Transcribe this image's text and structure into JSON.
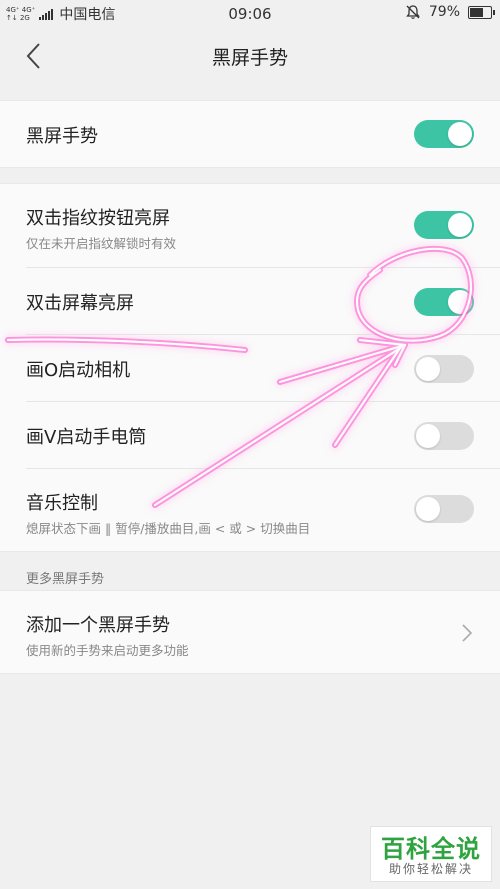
{
  "status_bar": {
    "network_top": "4G⁺ 4G⁺",
    "network_bottom": "↑↓ 2G",
    "carrier": "中国电信",
    "time": "09:06",
    "battery": "79%",
    "battery_level": 0.79
  },
  "navbar": {
    "title": "黑屏手势"
  },
  "section1": {
    "rows": [
      {
        "label": "黑屏手势",
        "enabled": true
      }
    ]
  },
  "section2": {
    "rows": [
      {
        "label": "双击指纹按钮亮屏",
        "sublabel": "仅在未开启指纹解锁时有效",
        "enabled": true
      },
      {
        "label": "双击屏幕亮屏",
        "enabled": true
      },
      {
        "label": "画O启动相机",
        "enabled": false
      },
      {
        "label": "画V启动手电筒",
        "enabled": false
      },
      {
        "label": "音乐控制",
        "sublabel": "熄屏状态下画 ‖ 暂停/播放曲目,画 < 或 > 切换曲目",
        "enabled": false
      }
    ]
  },
  "more_section": {
    "header": "更多黑屏手势",
    "add_row": {
      "label": "添加一个黑屏手势",
      "sublabel": "使用新的手势来启动更多功能"
    }
  },
  "watermark": {
    "title": "百科全说",
    "subtitle": "助你轻松解决"
  },
  "colors": {
    "toggle_on": "#3cc4a4",
    "toggle_off": "#dcdcdc",
    "annotation": "#ff33cc",
    "watermark_green": "#2fa33f"
  }
}
